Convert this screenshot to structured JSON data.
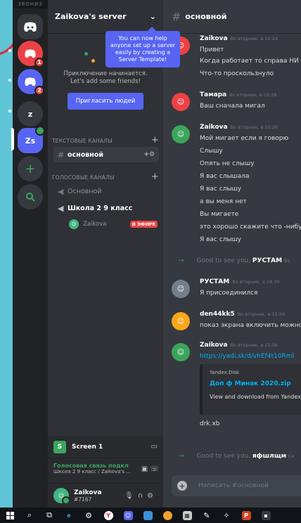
{
  "rail": {
    "top_strip": "ЗВОНИЗ",
    "servers": [
      {
        "label": "",
        "badge": "1",
        "color": "#ed4245"
      },
      {
        "label": "",
        "badge": "2",
        "color": "#5865f2"
      },
      {
        "label": "z",
        "color": "#36393f"
      },
      {
        "label": "Zs",
        "color": "#5865f2"
      }
    ]
  },
  "sidebar": {
    "server_name": "Zaikova's server",
    "tooltip": "You can now help anyone set up a server easily by creating a Server Template!",
    "welcome_line1": "Приключение начинается.",
    "welcome_line2": "Let's add some friends!",
    "invite_button": "Пригласить людей",
    "text_category": "ТЕКСТОВЫЕ КАНАЛЫ",
    "text_channel": "основной",
    "voice_category": "ГОЛОСОВЫЕ КАНАЛЫ",
    "voice_channels": [
      "Основной",
      "Школа 2 9 класс"
    ],
    "voice_user": "Zaikova",
    "live_badge": "В ЭФИРЕ",
    "screen_share": "Screen 1",
    "vc_status": "Голосовая связь подкл",
    "vc_sub": "Школа 2 9 класс / Zaikova's ...",
    "user_name": "Zaikova",
    "user_tag": "#7167"
  },
  "chat": {
    "channel": "основной",
    "messages": [
      {
        "author": "Zaikova",
        "time": "Во вторник, в 10:24",
        "lines": [
          "Привет",
          "Когда работает то справа НИ",
          "Что-то проскользнуло"
        ]
      },
      {
        "author": "Тамара",
        "time": "Во вторник, в 10:26",
        "lines": [
          "Ваш сначала мигал"
        ]
      },
      {
        "author": "Zaikova",
        "time": "Во вторник, в 10:26",
        "lines": [
          "Мой мигает если я говорю",
          "Слышу",
          "Опять не слышу",
          "Я вас слышала",
          "Я вас слышу",
          "а вы меня нет",
          "Вы мигаете",
          "это хорошо скажите что -нибу",
          "Я вас  слышу"
        ]
      },
      {
        "author": "РУСТАМ",
        "time": "Во вторник, в 14:30",
        "lines": [
          "Я присоединился"
        ]
      },
      {
        "author": "den44kk5",
        "time": "Во вторник, в 15:56",
        "lines": [
          "показ экрана включить можно"
        ]
      },
      {
        "author": "Zaikova",
        "time": "Во вторник, в 15:56",
        "lines": [
          "https://yadi.sk/d/vhEf4t10Rml",
          "drk.xb"
        ]
      }
    ],
    "join1_text": "Good to see you,",
    "join1_name": "РУСТАМ",
    "join1_tail": "Во",
    "join2_text": "Good to see you,",
    "join2_name": "яфшлщм",
    "join2_tail": "Се",
    "embed_provider": "Yandex.Disk",
    "embed_title": "Доп ф Минак 2020.zip",
    "embed_desc": "View and download from Yandex",
    "input_placeholder": "Написать #основной"
  }
}
